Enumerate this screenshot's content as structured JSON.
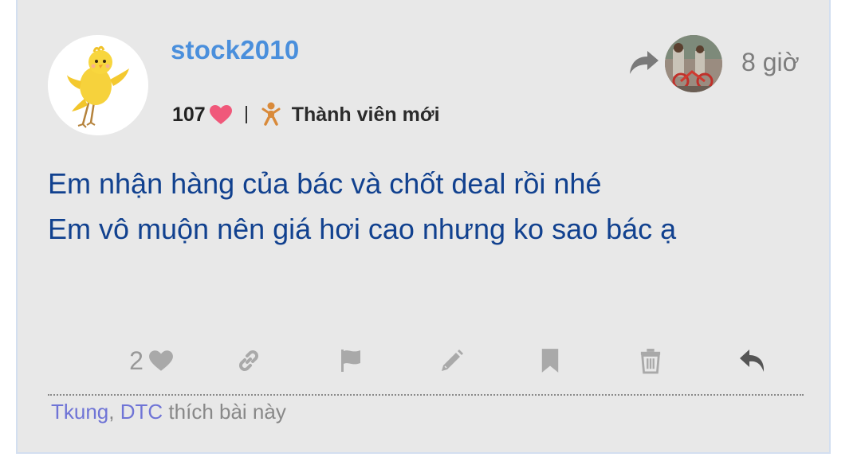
{
  "post": {
    "username": "stock2010",
    "likes_count": "107",
    "rank": "Thành viên mới",
    "time": "8 giờ",
    "content_lines": [
      "Em nhận hàng của bác và chốt deal rồi nhé",
      "Em vô muộn nên giá hơi cao nhưng ko sao bác ạ"
    ],
    "reaction_count": "2",
    "likers": [
      "Tkung",
      "DTC"
    ],
    "likers_separator": ",",
    "likers_suffix": "thích bài này"
  },
  "colors": {
    "username": "#4a8fdc",
    "content": "#11418f",
    "heart": "#f0587a",
    "rank_icon": "#d98a3a",
    "likers_link": "#6f74d6",
    "action_icon": "#a9a9a9",
    "reply_icon": "#555555"
  },
  "icons": {
    "avatar": "yellow-bird-avatar",
    "heart": "heart-icon",
    "rank": "baby-icon",
    "share": "share-icon",
    "actions": [
      "heart-icon",
      "link-icon",
      "flag-icon",
      "pencil-icon",
      "bookmark-icon",
      "trash-icon",
      "reply-icon"
    ]
  }
}
